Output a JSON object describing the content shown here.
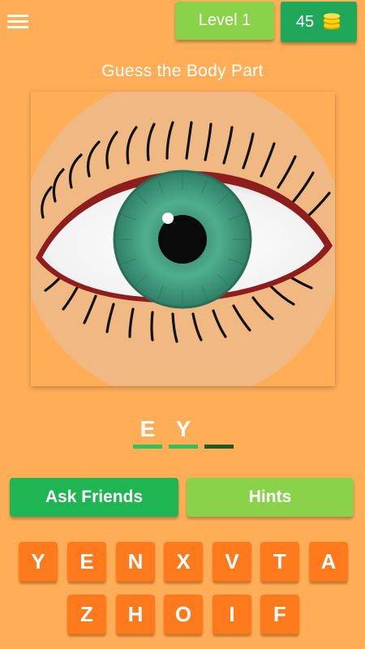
{
  "header": {
    "level_label": "Level 1",
    "coins": "45"
  },
  "title": "Guess the Body Part",
  "answer": {
    "slots": [
      "E",
      "Y",
      ""
    ]
  },
  "actions": {
    "ask_friends": "Ask Friends",
    "hints": "Hints"
  },
  "keyboard": {
    "row1": [
      "Y",
      "E",
      "N",
      "X",
      "V",
      "T",
      "A"
    ],
    "row2": [
      "Z",
      "H",
      "O",
      "I",
      "F"
    ]
  },
  "icons": {
    "menu": "hamburger-menu-icon",
    "coins": "coin-stack-icon"
  },
  "colors": {
    "background": "#FFAE57",
    "level_button": "#8BD24B",
    "coins_button": "#1FA85A",
    "ask_button": "#1FB553",
    "hints_button": "#8BD24B",
    "key": "#FF7A1C",
    "iris": "#3E9A7E"
  }
}
